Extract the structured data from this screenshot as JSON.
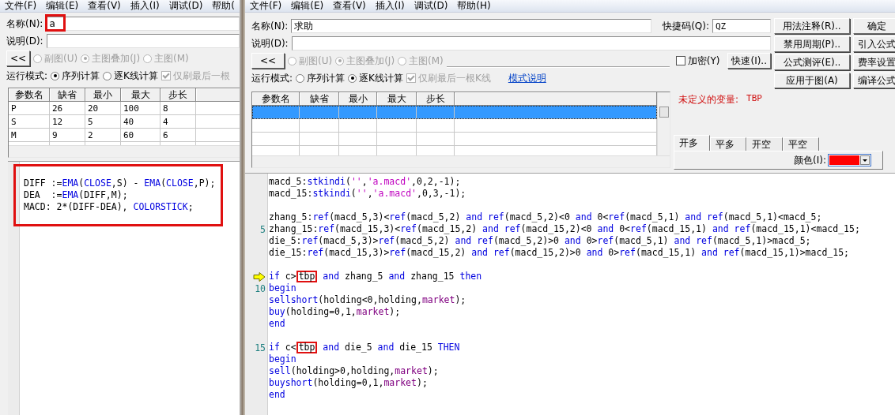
{
  "left": {
    "menu": [
      "文件(F)",
      "编辑(E)",
      "查看(V)",
      "插入(I)",
      "调试(D)",
      "帮助("
    ],
    "name": {
      "label": "名称(N):",
      "value": "a",
      "boxed": true
    },
    "description": {
      "label": "说明(D):"
    },
    "collapse_button": "<<",
    "chart_options": [
      {
        "label": "副图(U)",
        "selected": false,
        "disabled": true
      },
      {
        "label": "主图叠加(J)",
        "selected": true,
        "disabled": true
      },
      {
        "label": "主图(M)",
        "selected": false,
        "disabled": true
      }
    ],
    "run_mode": {
      "label": "运行模式:",
      "options": [
        {
          "label": "序列计算",
          "selected": true
        },
        {
          "label": "逐K线计算",
          "selected": false
        }
      ]
    },
    "refresh_last": {
      "label": "仅刷最后一根",
      "checked": true,
      "disabled": true
    },
    "params": {
      "columns": [
        "参数名",
        "缺省",
        "最小",
        "最大",
        "步长"
      ],
      "rows": [
        {
          "cells": [
            "P",
            "26",
            "20",
            "100",
            "8"
          ]
        },
        {
          "cells": [
            "S",
            "12",
            "5",
            "40",
            "4"
          ]
        },
        {
          "cells": [
            "M",
            "9",
            "2",
            "60",
            "6"
          ]
        }
      ]
    },
    "code": {
      "boxed": true,
      "lines": [
        {
          "tokens": [
            {
              "kind": "plain",
              "text": "DIFF :="
            },
            {
              "kind": "kw",
              "text": "EMA"
            },
            {
              "kind": "plain",
              "text": "("
            },
            {
              "kind": "kw",
              "text": "CLOSE"
            },
            {
              "kind": "plain",
              "text": ",S) - "
            },
            {
              "kind": "kw",
              "text": "EMA"
            },
            {
              "kind": "plain",
              "text": "("
            },
            {
              "kind": "kw",
              "text": "CLOSE"
            },
            {
              "kind": "plain",
              "text": ",P);"
            }
          ]
        },
        {
          "tokens": [
            {
              "kind": "plain",
              "text": "DEA  :="
            },
            {
              "kind": "kw",
              "text": "EMA"
            },
            {
              "kind": "plain",
              "text": "(DIFF,M);"
            }
          ]
        },
        {
          "tokens": [
            {
              "kind": "plain",
              "text": "MACD: 2*(DIFF-DEA), "
            },
            {
              "kind": "kw",
              "text": "COLORSTICK"
            },
            {
              "kind": "plain",
              "text": ";"
            }
          ]
        }
      ]
    }
  },
  "right": {
    "menu": [
      "文件(F)",
      "编辑(E)",
      "查看(V)",
      "插入(I)",
      "调试(D)",
      "帮助(H)"
    ],
    "name": {
      "label": "名称(N):",
      "value": "求助",
      "boxed": false
    },
    "shortcut": {
      "label": "快捷码(Q):",
      "value": "QZ"
    },
    "description": {
      "label": "说明(D):"
    },
    "collapse_button": "<<",
    "chart_options": [
      {
        "label": "副图(U)",
        "selected": false,
        "disabled": true
      },
      {
        "label": "主图叠加(J)",
        "selected": true,
        "disabled": true
      },
      {
        "label": "主图(M)",
        "selected": false,
        "disabled": true
      }
    ],
    "encrypt": {
      "label": "加密(Y)",
      "checked": false
    },
    "quick_button": "快速(I)..",
    "run_mode": {
      "label": "运行模式:",
      "options": [
        {
          "label": "序列计算",
          "selected": false
        },
        {
          "label": "逐K线计算",
          "selected": true
        }
      ]
    },
    "refresh_last": {
      "label": "仅刷最后一根K线",
      "checked": true,
      "disabled": true
    },
    "mode_link": "模式说明",
    "buttons": [
      "用法注释(R)..",
      "确定",
      "禁用周期(P)..",
      "引入公式",
      "公式测评(E)..",
      "费率设置",
      "应用于图(A)",
      "编译公式"
    ],
    "params": {
      "columns": [
        "参数名",
        "缺省",
        "最小",
        "最大",
        "步长"
      ],
      "rows": [
        {
          "selected": true
        },
        {
          "selected": false
        },
        {
          "selected": false
        },
        {
          "selected": false
        }
      ]
    },
    "error": {
      "label": "未定义的变量:",
      "value": "TBP"
    },
    "tabs": [
      {
        "label": "开多",
        "selected": true
      },
      {
        "label": "平多",
        "selected": false
      },
      {
        "label": "开空",
        "selected": false
      },
      {
        "label": "平空",
        "selected": false
      }
    ],
    "color": {
      "label": "颜色(I):",
      "color": "#ff0000"
    },
    "code": {
      "boxed": false,
      "lines": [
        {
          "kind": "code",
          "current": false,
          "tokens": [
            {
              "kind": "plain",
              "text": "macd_5:"
            },
            {
              "kind": "kw",
              "text": "stkindi"
            },
            {
              "kind": "plain",
              "text": "("
            },
            {
              "kind": "str",
              "text": "''"
            },
            {
              "kind": "plain",
              "text": ","
            },
            {
              "kind": "str",
              "text": "'a.macd'"
            },
            {
              "kind": "plain",
              "text": ",0,2,-1);"
            }
          ]
        },
        {
          "kind": "code",
          "current": false,
          "tokens": [
            {
              "kind": "plain",
              "text": "macd_15:"
            },
            {
              "kind": "kw",
              "text": "stkindi"
            },
            {
              "kind": "plain",
              "text": "("
            },
            {
              "kind": "str",
              "text": "''"
            },
            {
              "kind": "plain",
              "text": ","
            },
            {
              "kind": "str",
              "text": "'a.macd'"
            },
            {
              "kind": "plain",
              "text": ",0,3,-1);"
            }
          ]
        },
        {
          "kind": "blank"
        },
        {
          "kind": "code",
          "current": false,
          "tokens": [
            {
              "kind": "plain",
              "text": "zhang_5:"
            },
            {
              "kind": "kw",
              "text": "ref"
            },
            {
              "kind": "plain",
              "text": "(macd_5,3)<"
            },
            {
              "kind": "kw",
              "text": "ref"
            },
            {
              "kind": "plain",
              "text": "(macd_5,2) "
            },
            {
              "kind": "kw",
              "text": "and ref"
            },
            {
              "kind": "plain",
              "text": "(macd_5,2)<0 "
            },
            {
              "kind": "kw",
              "text": "and"
            },
            {
              "kind": "plain",
              "text": " 0<"
            },
            {
              "kind": "kw",
              "text": "ref"
            },
            {
              "kind": "plain",
              "text": "(macd_5,1) "
            },
            {
              "kind": "kw",
              "text": "and ref"
            },
            {
              "kind": "plain",
              "text": "(macd_5,1)<macd_5;"
            }
          ]
        },
        {
          "kind": "code",
          "number": "5",
          "current": false,
          "tokens": [
            {
              "kind": "plain",
              "text": "zhang_15:"
            },
            {
              "kind": "kw",
              "text": "ref"
            },
            {
              "kind": "plain",
              "text": "(macd_15,3)<"
            },
            {
              "kind": "kw",
              "text": "ref"
            },
            {
              "kind": "plain",
              "text": "(macd_15,2) "
            },
            {
              "kind": "kw",
              "text": "and ref"
            },
            {
              "kind": "plain",
              "text": "(macd_15,2)<0 "
            },
            {
              "kind": "kw",
              "text": "and"
            },
            {
              "kind": "plain",
              "text": " 0<"
            },
            {
              "kind": "kw",
              "text": "ref"
            },
            {
              "kind": "plain",
              "text": "(macd_15,1) "
            },
            {
              "kind": "kw",
              "text": "and ref"
            },
            {
              "kind": "plain",
              "text": "(macd_15,1)<macd_15;"
            }
          ]
        },
        {
          "kind": "code",
          "current": false,
          "tokens": [
            {
              "kind": "plain",
              "text": "die_5:"
            },
            {
              "kind": "kw",
              "text": "ref"
            },
            {
              "kind": "plain",
              "text": "(macd_5,3)>"
            },
            {
              "kind": "kw",
              "text": "ref"
            },
            {
              "kind": "plain",
              "text": "(macd_5,2) "
            },
            {
              "kind": "kw",
              "text": "and ref"
            },
            {
              "kind": "plain",
              "text": "(macd_5,2)>0 "
            },
            {
              "kind": "kw",
              "text": "and"
            },
            {
              "kind": "plain",
              "text": " 0>"
            },
            {
              "kind": "kw",
              "text": "ref"
            },
            {
              "kind": "plain",
              "text": "(macd_5,1) "
            },
            {
              "kind": "kw",
              "text": "and ref"
            },
            {
              "kind": "plain",
              "text": "(macd_5,1)>macd_5;"
            }
          ]
        },
        {
          "kind": "code",
          "current": false,
          "tokens": [
            {
              "kind": "plain",
              "text": "die_15:"
            },
            {
              "kind": "kw",
              "text": "ref"
            },
            {
              "kind": "plain",
              "text": "(macd_15,3)>"
            },
            {
              "kind": "kw",
              "text": "ref"
            },
            {
              "kind": "plain",
              "text": "(macd_15,2) "
            },
            {
              "kind": "kw",
              "text": "and ref"
            },
            {
              "kind": "plain",
              "text": "(macd_15,2)>0 "
            },
            {
              "kind": "kw",
              "text": "and"
            },
            {
              "kind": "plain",
              "text": " 0>"
            },
            {
              "kind": "kw",
              "text": "ref"
            },
            {
              "kind": "plain",
              "text": "(macd_15,1) "
            },
            {
              "kind": "kw",
              "text": "and ref"
            },
            {
              "kind": "plain",
              "text": "(macd_15,1)>macd_15;"
            }
          ]
        },
        {
          "kind": "blank"
        },
        {
          "kind": "code",
          "current": true,
          "tokens": [
            {
              "kind": "kw",
              "text": "if"
            },
            {
              "kind": "plain",
              "text": " c>"
            },
            {
              "kind": "boxed",
              "text": "tbp"
            },
            {
              "kind": "kw",
              "text": " and"
            },
            {
              "kind": "plain",
              "text": " zhang_5 "
            },
            {
              "kind": "kw",
              "text": "and"
            },
            {
              "kind": "plain",
              "text": " zhang_15 "
            },
            {
              "kind": "kw",
              "text": "then"
            }
          ]
        },
        {
          "kind": "code",
          "number": "10",
          "current": false,
          "tokens": [
            {
              "kind": "kw",
              "text": "begin"
            }
          ]
        },
        {
          "kind": "code",
          "current": false,
          "tokens": [
            {
              "kind": "kw",
              "text": "sellshort"
            },
            {
              "kind": "plain",
              "text": "(holding<0,holding,"
            },
            {
              "kind": "const",
              "text": "market"
            },
            {
              "kind": "plain",
              "text": ");"
            }
          ]
        },
        {
          "kind": "code",
          "current": false,
          "tokens": [
            {
              "kind": "kw",
              "text": "buy"
            },
            {
              "kind": "plain",
              "text": "(holding=0,1,"
            },
            {
              "kind": "const",
              "text": "market"
            },
            {
              "kind": "plain",
              "text": ");"
            }
          ]
        },
        {
          "kind": "code",
          "current": false,
          "tokens": [
            {
              "kind": "kw",
              "text": "end"
            }
          ]
        },
        {
          "kind": "blank"
        },
        {
          "kind": "code",
          "number": "15",
          "current": false,
          "tokens": [
            {
              "kind": "kw",
              "text": "if"
            },
            {
              "kind": "plain",
              "text": " c<"
            },
            {
              "kind": "boxed",
              "text": "tbp"
            },
            {
              "kind": "kw",
              "text": " and"
            },
            {
              "kind": "plain",
              "text": " die_5 "
            },
            {
              "kind": "kw",
              "text": "and"
            },
            {
              "kind": "plain",
              "text": " die_15 "
            },
            {
              "kind": "kw",
              "text": "THEN"
            }
          ]
        },
        {
          "kind": "code",
          "current": false,
          "tokens": [
            {
              "kind": "kw",
              "text": "begin"
            }
          ]
        },
        {
          "kind": "code",
          "current": false,
          "tokens": [
            {
              "kind": "kw",
              "text": "sell"
            },
            {
              "kind": "plain",
              "text": "(holding>0,holding,"
            },
            {
              "kind": "const",
              "text": "market"
            },
            {
              "kind": "plain",
              "text": ");"
            }
          ]
        },
        {
          "kind": "code",
          "current": false,
          "tokens": [
            {
              "kind": "kw",
              "text": "buyshort"
            },
            {
              "kind": "plain",
              "text": "(holding=0,1,"
            },
            {
              "kind": "const",
              "text": "market"
            },
            {
              "kind": "plain",
              "text": ");"
            }
          ]
        },
        {
          "kind": "code",
          "current": false,
          "tokens": [
            {
              "kind": "kw",
              "text": "end"
            }
          ]
        }
      ]
    }
  }
}
